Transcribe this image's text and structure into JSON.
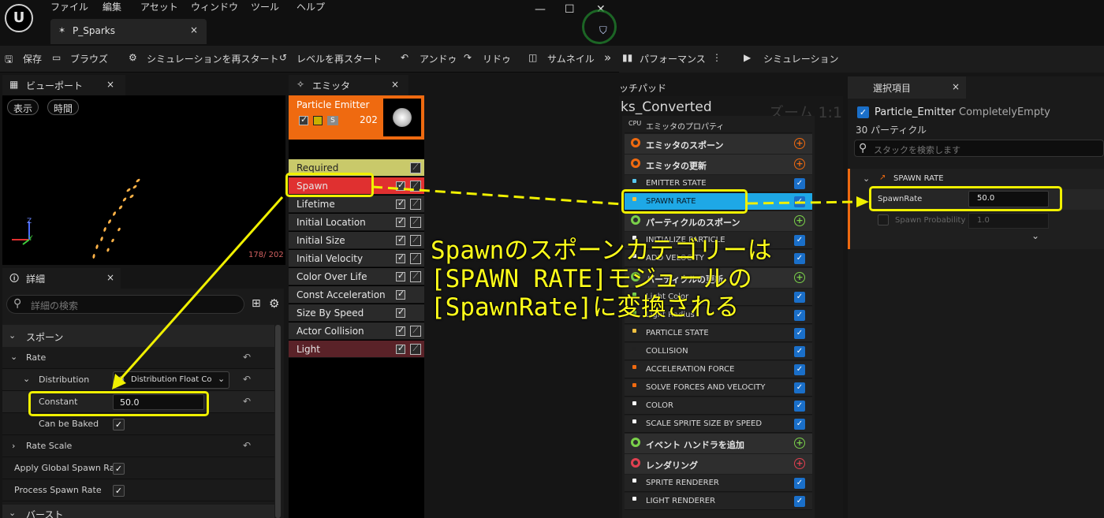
{
  "menu": [
    "ファイル",
    "編集",
    "アセット",
    "ウィンドウ",
    "ツール",
    "ヘルプ"
  ],
  "asset_tab": {
    "label": "P_Sparks",
    "close": "×"
  },
  "window_controls": {
    "minimize": "—",
    "maximize": "☐",
    "close": "✕"
  },
  "toolbar": {
    "save": "保存",
    "browse": "ブラウズ",
    "restart_sim": "シミュレーションを再スタート",
    "restart_level": "レベルを再スタート",
    "undo": "アンドゥ",
    "redo": "リドゥ",
    "thumbnail": "サムネイル",
    "more": "»"
  },
  "viewport": {
    "tab_label": "ビューポート",
    "close": "×",
    "show_button": "表示",
    "time_button": "時間",
    "particle_count": "178/ 202",
    "axis_z": "Z",
    "axis_y": "Y"
  },
  "emitter_panel": {
    "tab_label": "エミッタ",
    "close": "×",
    "emitter_name": "Particle Emitter",
    "emitter_count": "202",
    "modules": [
      {
        "label": "Required",
        "color": "#c9c96a",
        "graph": true,
        "check": false
      },
      {
        "label": "Spawn",
        "color": "#e03030",
        "graph": true,
        "check": true
      },
      {
        "label": "Lifetime",
        "color": "#2a2a2a",
        "graph": true,
        "check": true
      },
      {
        "label": "Initial Location",
        "color": "#2a2a2a",
        "graph": true,
        "check": true
      },
      {
        "label": "Initial Size",
        "color": "#2a2a2a",
        "graph": true,
        "check": true
      },
      {
        "label": "Initial Velocity",
        "color": "#2a2a2a",
        "graph": true,
        "check": true
      },
      {
        "label": "Color Over Life",
        "color": "#2a2a2a",
        "graph": true,
        "check": true
      },
      {
        "label": "Const Acceleration",
        "color": "#2a2a2a",
        "graph": false,
        "check": true
      },
      {
        "label": "Size By Speed",
        "color": "#2a2a2a",
        "graph": false,
        "check": true
      },
      {
        "label": "Actor Collision",
        "color": "#2a2a2a",
        "graph": true,
        "check": true
      },
      {
        "label": "Light",
        "color": "#5a2228",
        "graph": true,
        "check": true
      }
    ]
  },
  "details": {
    "tab_label": "詳細",
    "close": "×",
    "search_placeholder": "詳細の検索",
    "section_spawn": "スポーン",
    "rate_label": "Rate",
    "distribution_label": "Distribution",
    "distribution_value": "Distribution Float Co",
    "constant_label": "Constant",
    "constant_value": "50.0",
    "can_be_baked_label": "Can be Baked",
    "rate_scale_label": "Rate Scale",
    "apply_global_label": "Apply Global Spawn Ra",
    "process_spawn_label": "Process Spawn Rate",
    "section_burst": "バースト"
  },
  "right_toolbar": {
    "performance": "パフォーマンス",
    "more": "⋮",
    "simulation": "シミュレーション"
  },
  "scratchpad": {
    "tab_label": "ッチパッド",
    "emitter_title": "ks_Converted",
    "zoom_label": "ズーム 1:1"
  },
  "stack": {
    "items": [
      {
        "label": "エミッタのプロパティ",
        "kind": "row-plain",
        "prefix": "CPU"
      },
      {
        "label": "エミッタのスポーン",
        "kind": "group",
        "icon_color": "#ef6a10",
        "circle": "+",
        "circle_color": "#ef6a10"
      },
      {
        "label": "エミッタの更新",
        "kind": "group",
        "icon_color": "#ef6a10",
        "circle": "+",
        "circle_color": "#ef6a10"
      },
      {
        "label": "EMITTER STATE",
        "kind": "row",
        "dot": "#58c8f0"
      },
      {
        "label": "SPAWN RATE",
        "kind": "row-selected",
        "dot": "#f0c040"
      },
      {
        "label": "パーティクルのスポーン",
        "kind": "group",
        "icon_color": "#7ad04a",
        "circle": "+",
        "circle_color": "#7ad04a"
      },
      {
        "label": "INITIALIZE PARTICLE",
        "kind": "row",
        "dot": "#ffffff"
      },
      {
        "label": "ADD VELOCITY",
        "kind": "row",
        "dot": "#ffffff"
      },
      {
        "label": "パーティクルの更新",
        "kind": "group",
        "icon_color": "#7ad04a",
        "circle": "+",
        "circle_color": "#7ad04a"
      },
      {
        "label": "Light Color",
        "kind": "row",
        "dot": "#7ad04a"
      },
      {
        "label": "Light Radius",
        "kind": "row",
        "dot": "#7ad04a"
      },
      {
        "label": "PARTICLE STATE",
        "kind": "row",
        "dot": "#f0c040"
      },
      {
        "label": "COLLISION",
        "kind": "row",
        "dot": "#222222"
      },
      {
        "label": "ACCELERATION FORCE",
        "kind": "row",
        "dot": "#ef6a10"
      },
      {
        "label": "SOLVE FORCES AND VELOCITY",
        "kind": "row",
        "dot": "#ef6a10"
      },
      {
        "label": "COLOR",
        "kind": "row",
        "dot": "#ffffff"
      },
      {
        "label": "SCALE SPRITE SIZE BY SPEED",
        "kind": "row",
        "dot": "#ffffff"
      },
      {
        "label": "イベント ハンドラを追加",
        "kind": "group",
        "icon_color": "#7ad04a",
        "circle": "+",
        "circle_color": "#7ad04a"
      },
      {
        "label": "レンダリング",
        "kind": "group",
        "icon_color": "#e04050",
        "circle": "+",
        "circle_color": "#e04050"
      },
      {
        "label": "SPRITE RENDERER",
        "kind": "row",
        "dot": "#ffffff"
      },
      {
        "label": "LIGHT RENDERER",
        "kind": "row",
        "dot": "#ffffff"
      }
    ]
  },
  "selection": {
    "tab_label": "選択項目",
    "close": "×",
    "emitter_name": "Particle_Emitter",
    "emitter_suffix": "CompletelyEmpty",
    "particle_count": "30 パーティクル",
    "search_placeholder": "スタックを検索します",
    "section": "SPAWN RATE",
    "spawnrate_label": "SpawnRate",
    "spawnrate_value": "50.0",
    "probability_label": "Spawn Probability",
    "probability_value": "1.0",
    "expand": "⌄"
  },
  "annotation": {
    "line1": "Spawnのスポーンカテゴリーは",
    "line2": "[SPAWN RATE]モジュールの",
    "line3": "[SpawnRate]に変換される"
  },
  "colors": {
    "accent_orange": "#ef6a10",
    "highlight_yellow": "#f0f000",
    "selected_blue": "#1ea8e6",
    "spawn_red": "#e03030"
  }
}
